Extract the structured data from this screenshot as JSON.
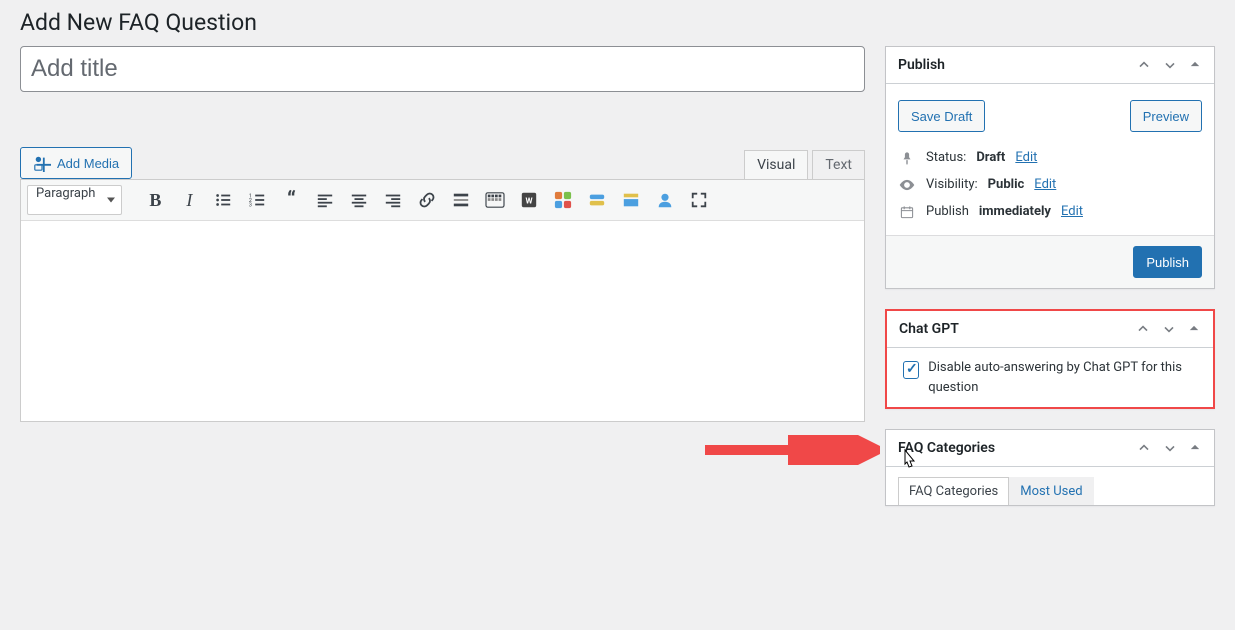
{
  "page": {
    "title": "Add New FAQ Question"
  },
  "title_input": {
    "placeholder": "Add title",
    "value": ""
  },
  "media_button": {
    "label": "Add Media"
  },
  "editor_tabs": {
    "visual": "Visual",
    "text": "Text"
  },
  "format_dropdown": {
    "label": "Paragraph"
  },
  "sidebar": {
    "publish": {
      "title": "Publish",
      "save_draft": "Save Draft",
      "preview": "Preview",
      "status_label": "Status:",
      "status_value": "Draft",
      "status_edit": "Edit",
      "visibility_label": "Visibility:",
      "visibility_value": "Public",
      "visibility_edit": "Edit",
      "publish_label": "Publish",
      "publish_value": "immediately",
      "publish_edit": "Edit",
      "submit": "Publish"
    },
    "chatgpt": {
      "title": "Chat GPT",
      "disable_label": "Disable auto-answering by Chat GPT for this question",
      "checked": true
    },
    "categories": {
      "title": "FAQ Categories",
      "tab_all": "FAQ Categories",
      "tab_used": "Most Used"
    }
  }
}
